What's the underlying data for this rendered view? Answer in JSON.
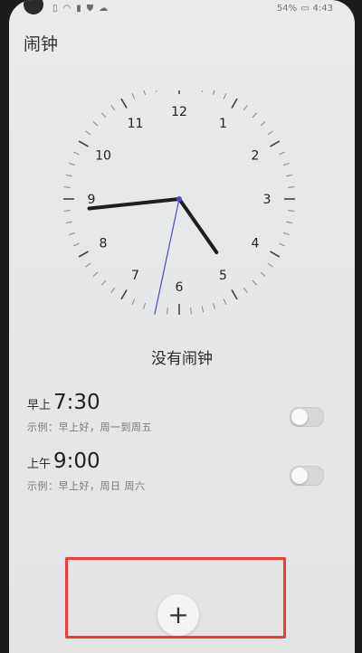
{
  "status_bar": {
    "left_icons": [
      "sim-icon",
      "wifi-icon",
      "notification-icon",
      "notification-icon",
      "shield-icon",
      "cloud-icon"
    ],
    "battery": "54%",
    "time": "4:43"
  },
  "header": {
    "title": "闹钟"
  },
  "clock": {
    "numerals": [
      "12",
      "1",
      "2",
      "3",
      "4",
      "5",
      "6",
      "7",
      "8",
      "9",
      "10",
      "11"
    ],
    "hour": 4,
    "minute": 45,
    "second": 33
  },
  "empty_state": {
    "text": "没有闹钟"
  },
  "alarms": [
    {
      "period": "早上",
      "time": "7:30",
      "description": "示例：早上好，周一到周五",
      "enabled": false
    },
    {
      "period": "上午",
      "time": "9:00",
      "description": "示例：早上好，周日 周六",
      "enabled": false
    }
  ],
  "fab": {
    "icon": "plus-icon",
    "label": "+"
  },
  "colors": {
    "highlight": "#ee3b34",
    "second_hand": "#4b4fb8",
    "hands": "#1e1e1e"
  }
}
